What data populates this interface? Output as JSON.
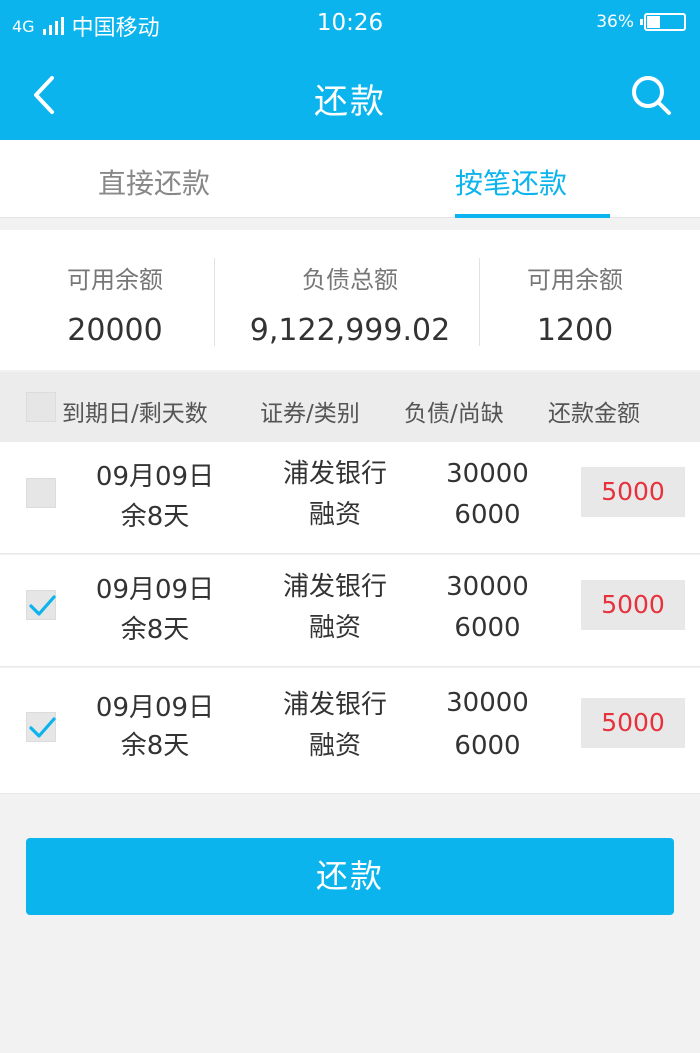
{
  "status_bar": {
    "network": "4G",
    "carrier": "中国移动",
    "time": "10:26",
    "battery": "36%",
    "battery_level": 0.36
  },
  "navbar": {
    "title": "还款",
    "back_icon": "chevron-left-icon",
    "search_icon": "search-icon"
  },
  "tabs": [
    {
      "label": "直接还款",
      "active": false
    },
    {
      "label": "按笔还款",
      "active": true
    }
  ],
  "summary": [
    {
      "label": "可用余额",
      "value": "20000"
    },
    {
      "label": "负债总额",
      "value": "9,122,999.02"
    },
    {
      "label": "可用余额",
      "value": "1200"
    }
  ],
  "table": {
    "headers": [
      "到期日/剩天数",
      "证券/类别",
      "负债/尚缺",
      "还款金额"
    ],
    "rows": [
      {
        "checked": false,
        "date": "09月09日",
        "days": "余8天",
        "security": "浦发银行",
        "category": "融资",
        "debt": "30000",
        "shortage": "6000",
        "amount": "5000"
      },
      {
        "checked": true,
        "date": "09月09日",
        "days": "余8天",
        "security": "浦发银行",
        "category": "融资",
        "debt": "30000",
        "shortage": "6000",
        "amount": "5000"
      },
      {
        "checked": true,
        "date": "09月09日",
        "days": "余8天",
        "security": "浦发银行",
        "category": "融资",
        "debt": "30000",
        "shortage": "6000",
        "amount": "5000"
      }
    ]
  },
  "action": {
    "label": "还款"
  },
  "colors": {
    "primary": "#0bb4ec",
    "amount": "#e6323c"
  }
}
